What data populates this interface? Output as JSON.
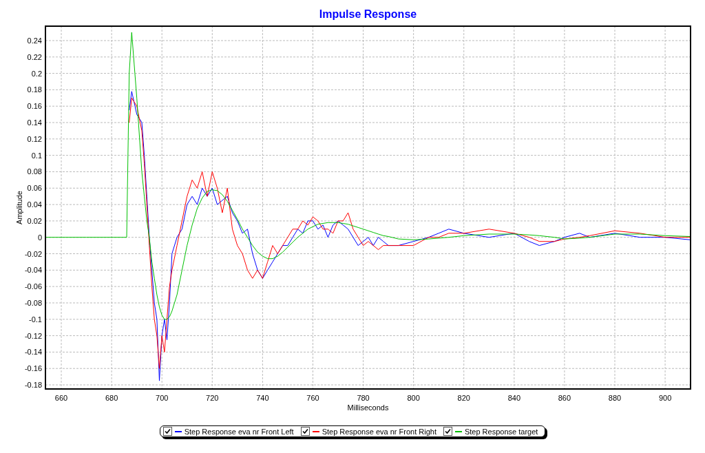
{
  "chart_data": {
    "type": "line",
    "grid": true,
    "title": "Impulse Response",
    "xlabel": "Milliseconds",
    "ylabel": "Amplitude",
    "xlim": [
      653.7,
      910.1
    ],
    "ylim": [
      -0.185,
      0.2576
    ],
    "xticks": [
      660,
      680,
      700,
      720,
      740,
      760,
      780,
      800,
      820,
      840,
      860,
      880,
      900
    ],
    "yticks": [
      -0.18,
      -0.16,
      -0.14,
      -0.12,
      -0.1,
      -0.08,
      -0.06,
      -0.04,
      -0.02,
      0,
      0.02,
      0.04,
      0.06,
      0.08,
      0.1,
      0.12,
      0.14,
      0.16,
      0.18,
      0.2,
      0.22,
      0.24
    ],
    "x": [
      654,
      660,
      670,
      680,
      684,
      686,
      687,
      688,
      690,
      692,
      693,
      694,
      695,
      696,
      697,
      698,
      699,
      700,
      701,
      702,
      703,
      704,
      706,
      708,
      710,
      712,
      714,
      716,
      718,
      720,
      722,
      724,
      726,
      728,
      730,
      732,
      734,
      736,
      738,
      740,
      742,
      744,
      746,
      748,
      750,
      752,
      754,
      756,
      758,
      760,
      762,
      764,
      766,
      768,
      770,
      772,
      774,
      776,
      778,
      780,
      782,
      784,
      786,
      788,
      790,
      794,
      800,
      806,
      810,
      814,
      820,
      830,
      840,
      846,
      850,
      856,
      860,
      866,
      870,
      880,
      890,
      900,
      910
    ],
    "series": [
      {
        "name": "Step Response eva nr Front Left",
        "color": "#0000ff",
        "values": [
          null,
          null,
          null,
          null,
          null,
          null,
          0.155,
          0.178,
          0.15,
          0.14,
          0.1,
          0.05,
          0,
          -0.04,
          -0.08,
          -0.1,
          -0.175,
          -0.12,
          -0.1,
          -0.125,
          -0.08,
          -0.02,
          0,
          0.01,
          0.04,
          0.05,
          0.04,
          0.06,
          0.05,
          0.06,
          0.04,
          0.045,
          0.05,
          0.03,
          0.02,
          0.005,
          0.01,
          -0.02,
          -0.04,
          -0.05,
          -0.04,
          -0.03,
          -0.02,
          -0.01,
          -0.01,
          0,
          0.01,
          0.005,
          0.02,
          0.02,
          0.01,
          0.015,
          0,
          0.015,
          0.02,
          0.015,
          0.01,
          0,
          -0.01,
          -0.005,
          0,
          -0.01,
          0,
          -0.005,
          -0.01,
          -0.01,
          -0.005,
          0,
          0.005,
          0.01,
          0.005,
          0,
          0.005,
          -0.005,
          -0.01,
          -0.005,
          0,
          0.005,
          0,
          0.005,
          0,
          0,
          -0.003
        ]
      },
      {
        "name": "Step Response eva nr Front Right",
        "color": "#ff0000",
        "values": [
          null,
          null,
          null,
          null,
          null,
          null,
          0.14,
          0.17,
          0.16,
          0.13,
          0.09,
          0.04,
          -0.01,
          -0.06,
          -0.1,
          -0.12,
          -0.16,
          -0.12,
          -0.14,
          -0.1,
          -0.06,
          -0.04,
          -0.01,
          0.02,
          0.05,
          0.07,
          0.06,
          0.08,
          0.05,
          0.08,
          0.06,
          0.03,
          0.06,
          0.01,
          -0.01,
          -0.02,
          -0.04,
          -0.05,
          -0.04,
          -0.05,
          -0.03,
          -0.01,
          -0.02,
          -0.01,
          0,
          0.01,
          0.01,
          0.02,
          0.015,
          0.025,
          0.02,
          0.01,
          0.01,
          0.005,
          0.02,
          0.02,
          0.03,
          0.01,
          0,
          -0.01,
          -0.005,
          -0.01,
          -0.015,
          -0.01,
          -0.01,
          -0.01,
          -0.01,
          0,
          0,
          0.005,
          0.005,
          0.01,
          0.005,
          0,
          -0.005,
          -0.005,
          -0.002,
          0,
          0.002,
          0.008,
          0.005,
          0,
          0
        ]
      },
      {
        "name": "Step Response target",
        "color": "#00c000",
        "values": [
          0,
          0,
          0,
          0,
          0,
          0,
          0.2,
          0.25,
          0.17,
          0.08,
          0.05,
          0.02,
          0,
          -0.03,
          -0.05,
          -0.07,
          -0.085,
          -0.095,
          -0.1,
          -0.1,
          -0.097,
          -0.09,
          -0.07,
          -0.04,
          -0.01,
          0.015,
          0.035,
          0.048,
          0.056,
          0.058,
          0.057,
          0.052,
          0.044,
          0.033,
          0.022,
          0.01,
          0,
          -0.01,
          -0.018,
          -0.023,
          -0.026,
          -0.026,
          -0.023,
          -0.018,
          -0.012,
          -0.006,
          0,
          0.005,
          0.01,
          0.013,
          0.016,
          0.017,
          0.018,
          0.018,
          0.018,
          0.017,
          0.016,
          0.014,
          0.012,
          0.01,
          0.008,
          0.006,
          0.004,
          0.002,
          0.001,
          -0.002,
          -0.003,
          -0.002,
          -0.001,
          0,
          0.002,
          0.004,
          0.004,
          0.003,
          0.002,
          0,
          -0.002,
          -0.001,
          0,
          0.004,
          0.004,
          0.002,
          0.001
        ]
      }
    ]
  },
  "legend": {
    "items": [
      {
        "checked": true
      },
      {
        "checked": true
      },
      {
        "checked": true
      }
    ]
  }
}
